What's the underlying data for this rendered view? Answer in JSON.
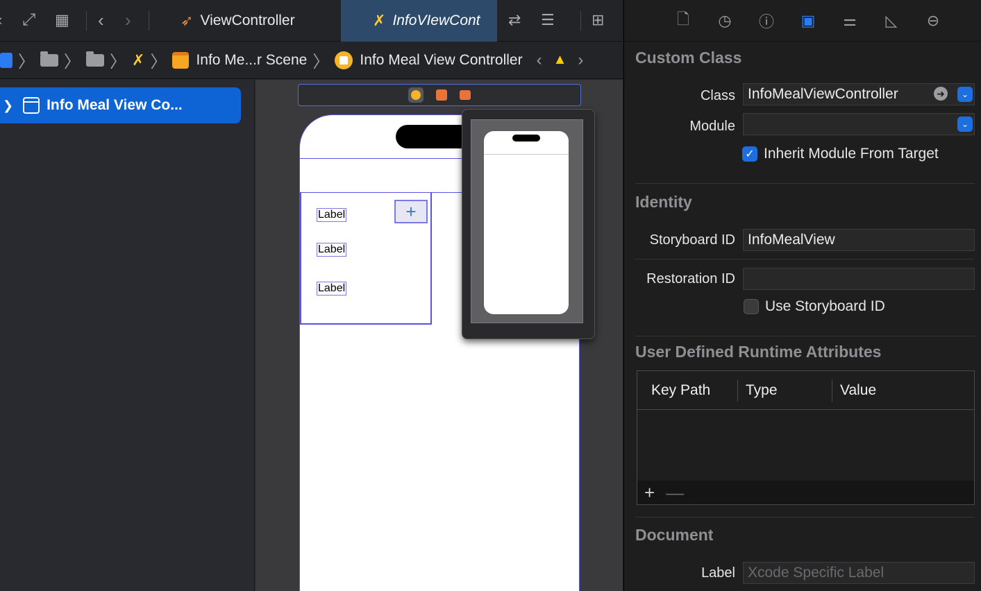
{
  "tabs": [
    {
      "label": "ViewController",
      "icon": "swift-file-icon"
    },
    {
      "label": "InfoVIewCont",
      "icon": "interface-builder-icon"
    }
  ],
  "breadcrumb": {
    "items": [
      "Info Me...r Scene",
      "Info Meal View Controller"
    ]
  },
  "outline": {
    "selected_item": "Info Meal View Co..."
  },
  "canvas": {
    "labels": [
      "Label",
      "Label",
      "Label"
    ],
    "add_button": "+"
  },
  "inspector": {
    "custom_class": {
      "title": "Custom Class",
      "class_label": "Class",
      "class_value": "InfoMealViewController",
      "module_label": "Module",
      "module_value": "",
      "inherit_label": "Inherit Module From Target",
      "inherit_checked": true
    },
    "identity": {
      "title": "Identity",
      "storyboard_id_label": "Storyboard ID",
      "storyboard_id_value": "InfoMealView",
      "restoration_id_label": "Restoration ID",
      "restoration_id_value": "",
      "use_storyboard_label": "Use Storyboard ID",
      "use_storyboard_checked": false
    },
    "runtime_attributes": {
      "title": "User Defined Runtime Attributes",
      "columns": [
        "Key Path",
        "Type",
        "Value"
      ],
      "add": "+",
      "remove": "—"
    },
    "document": {
      "title": "Document",
      "label_label": "Label",
      "label_placeholder": "Xcode Specific Label"
    }
  },
  "colors": {
    "accent": "#1d6fe0",
    "warning": "#ffcc00"
  }
}
